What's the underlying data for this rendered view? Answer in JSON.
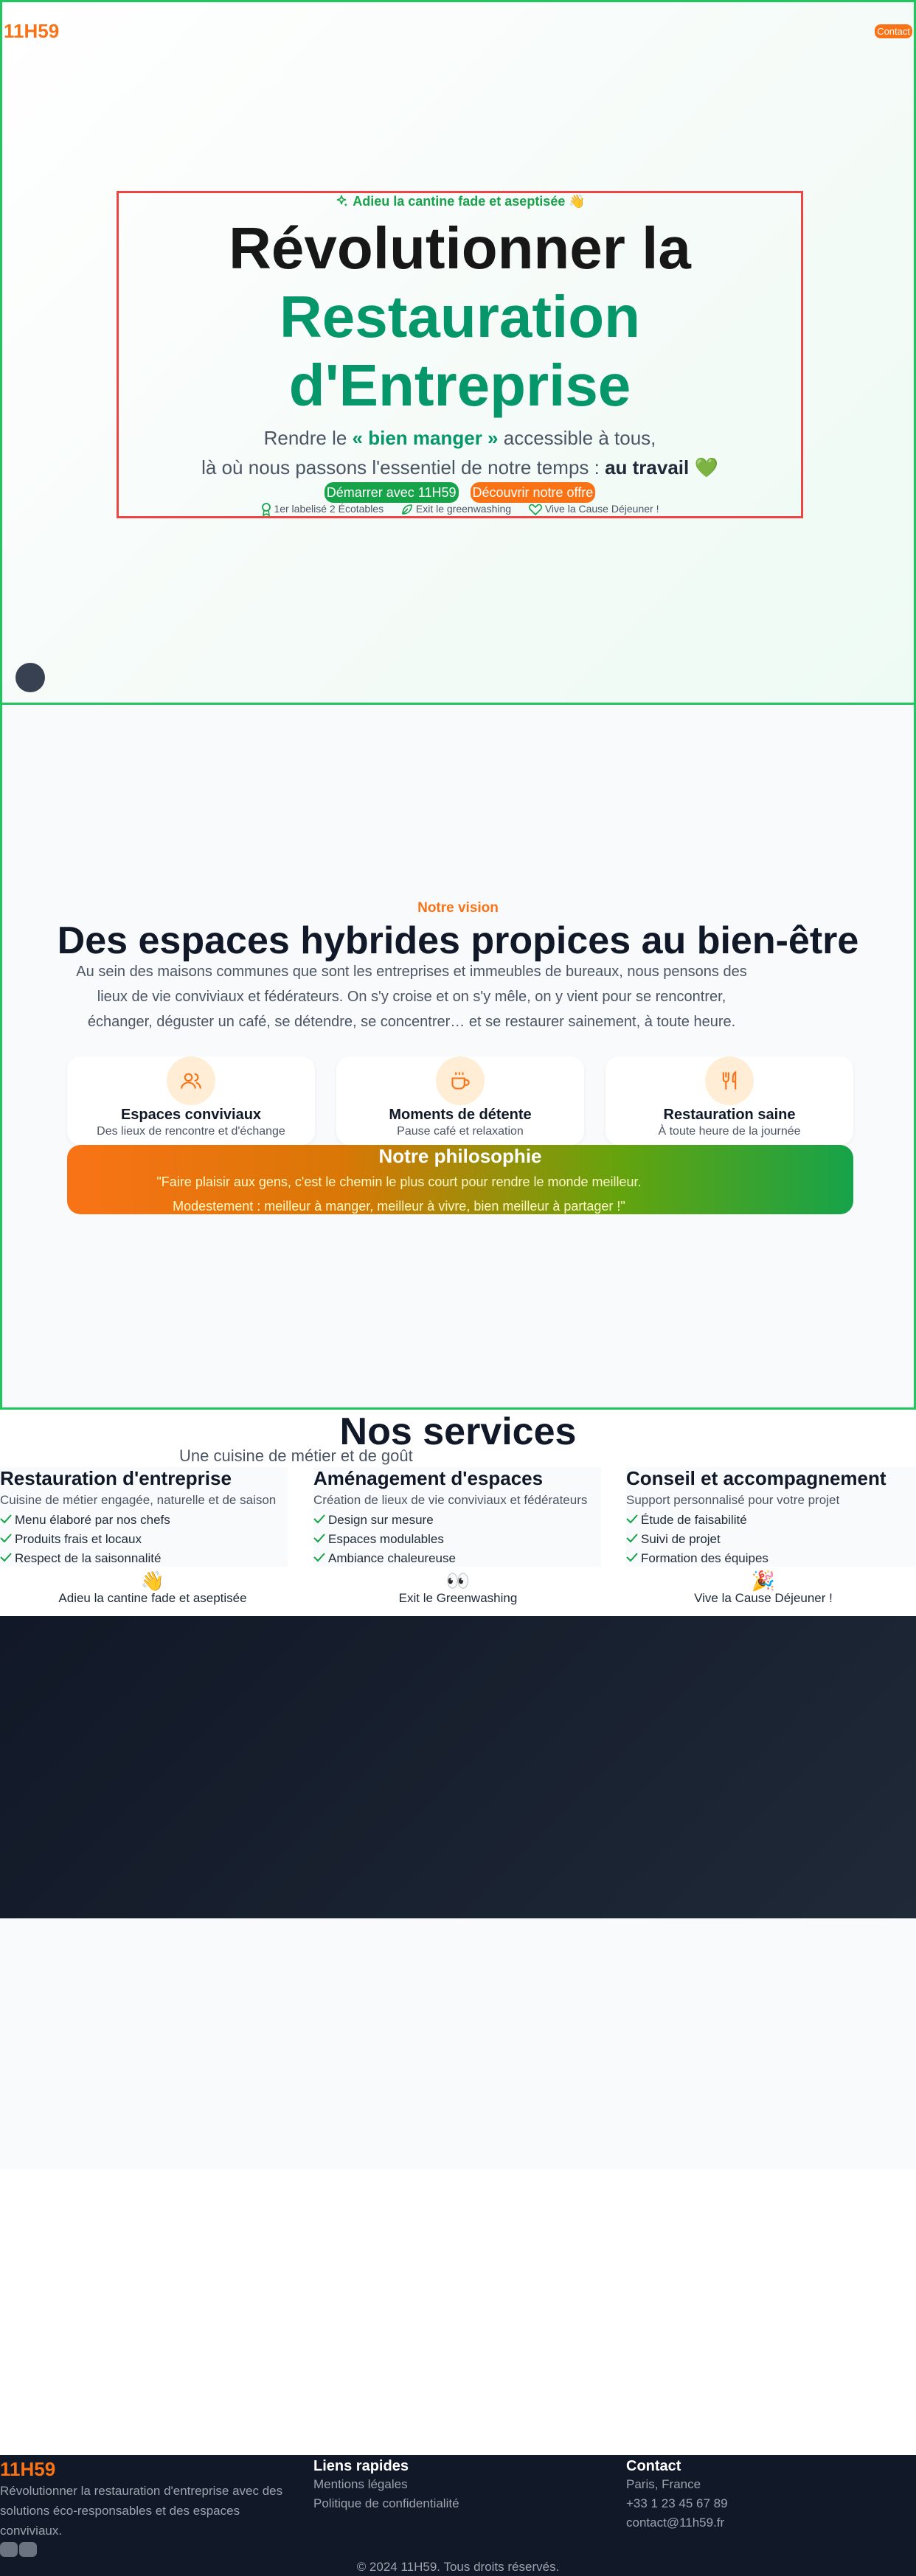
{
  "brand": {
    "logo": "11H59",
    "accent": "#f97316",
    "green": "#059669"
  },
  "nav": {
    "contact_label": "Contact"
  },
  "hero": {
    "kicker": "Adieu la cantine fade et aseptisée 👋",
    "title_line1": "Révolutionner la",
    "title_line2": "Restauration",
    "title_line3": "d'Entreprise",
    "subtitle_part1": "Rendre le ",
    "subtitle_highlight": "« bien manger »",
    "subtitle_part2": " accessible à tous,",
    "subtitle_line2": "là où nous passons l'essentiel de notre temps : ",
    "subtitle_bold": "au travail",
    "subtitle_emoji": "💚",
    "cta_primary": "Démarrer avec 11H59",
    "cta_secondary": "Découvrir notre offre",
    "badges": [
      "1er labelisé 2 Écotables",
      "Exit le greenwashing",
      "Vive la Cause Déjeuner !"
    ]
  },
  "vision": {
    "tag": "Notre vision",
    "title": "Des espaces hybrides propices au bien-être",
    "text": "Au sein des maisons communes que sont les entreprises et immeubles de bureaux, nous pensons des lieux de vie conviviaux et fédérateurs. On s'y croise et on s'y mêle, on y vient pour se rencontrer, échanger, déguster un café, se détendre, se concentrer… et se restaurer sainement, à toute heure.",
    "cards": [
      {
        "icon": "users-icon",
        "title": "Espaces conviviaux",
        "desc": "Des lieux de rencontre et d'échange"
      },
      {
        "icon": "coffee-icon",
        "title": "Moments de détente",
        "desc": "Pause café et relaxation"
      },
      {
        "icon": "utensils-icon",
        "title": "Restauration saine",
        "desc": "À toute heure de la journée"
      }
    ],
    "philosophy": {
      "title": "Notre philosophie",
      "quote_line1": "\"Faire plaisir aux gens, c'est le chemin le plus court pour rendre le monde meilleur.",
      "quote_line2": "Modestement : meilleur à manger, meilleur à vivre, bien meilleur à partager !\""
    }
  },
  "services": {
    "title": "Nos services",
    "subtitle": "Une cuisine de métier et de goût",
    "items": [
      {
        "title": "Restauration d'entreprise",
        "desc": "Cuisine de métier engagée, naturelle et de saison",
        "points": [
          "Menu élaboré par nos chefs",
          "Produits frais et locaux",
          "Respect de la saisonnalité"
        ]
      },
      {
        "title": "Aménagement d'espaces",
        "desc": "Création de lieux de vie conviviaux et fédérateurs",
        "points": [
          "Design sur mesure",
          "Espaces modulables",
          "Ambiance chaleureuse"
        ]
      },
      {
        "title": "Conseil et accompagnement",
        "desc": "Support personnalisé pour votre projet",
        "points": [
          "Étude de faisabilité",
          "Suivi de projet",
          "Formation des équipes"
        ]
      }
    ],
    "mottos": [
      {
        "emoji": "👋",
        "label": "Adieu la cantine fade et aseptisée"
      },
      {
        "emoji": "👀",
        "label": "Exit le Greenwashing"
      },
      {
        "emoji": "🎉",
        "label": "Vive la Cause Déjeuner !"
      }
    ]
  },
  "footer": {
    "logo": "11H59",
    "description": "Révolutionner la restauration d'entreprise avec des solutions éco-responsables et des espaces conviviaux.",
    "links_title": "Liens rapides",
    "links": [
      "Mentions légales",
      "Politique de confidentialité"
    ],
    "contact_title": "Contact",
    "contact": [
      "Paris, France",
      "+33 1 23 45 67 89",
      "contact@11h59.fr"
    ],
    "copyright": "© 2024 11H59. Tous droits réservés."
  }
}
